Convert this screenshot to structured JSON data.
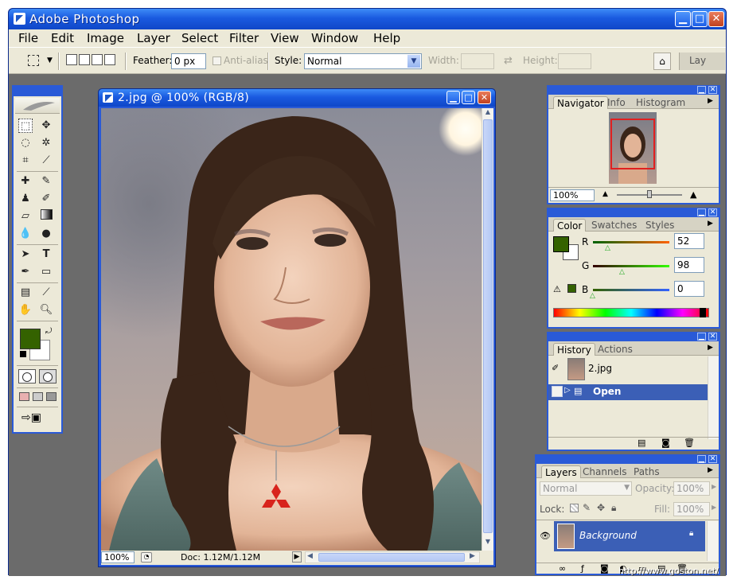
{
  "app": {
    "title": "Adobe  Photoshop",
    "menu": [
      "File",
      "Edit",
      "Image",
      "Layer",
      "Select",
      "Filter",
      "View",
      "Window",
      "Help"
    ]
  },
  "options_bar": {
    "feather_label": "Feather:",
    "feather_value": "0 px",
    "antialias_label": "Anti-alias",
    "style_label": "Style:",
    "style_value": "Normal",
    "width_label": "Width:",
    "height_label": "Height:",
    "palette_well_tab": "Lay"
  },
  "document": {
    "title": "2.jpg  @  100%  (RGB/8)",
    "zoom": "100%",
    "doc_size": "Doc: 1.12M/1.12M"
  },
  "navigator": {
    "tabs": [
      "Navigator",
      "Info",
      "Histogram"
    ],
    "zoom": "100%"
  },
  "color": {
    "tabs": [
      "Color",
      "Swatches",
      "Styles"
    ],
    "channels": [
      {
        "label": "R",
        "value": "52"
      },
      {
        "label": "G",
        "value": "98"
      },
      {
        "label": "B",
        "value": "0"
      }
    ],
    "foreground": "#346200"
  },
  "history": {
    "tabs": [
      "History",
      "Actions"
    ],
    "snapshot": "2.jpg",
    "items": [
      "Open"
    ]
  },
  "layers": {
    "tabs": [
      "Layers",
      "Channels",
      "Paths"
    ],
    "blend_mode": "Normal",
    "opacity_label": "Opacity:",
    "opacity_value": "100%",
    "lock_label": "Lock:",
    "fill_label": "Fill:",
    "fill_value": "100%",
    "layer_name": "Background"
  },
  "watermark": "http://www.goston.net/"
}
